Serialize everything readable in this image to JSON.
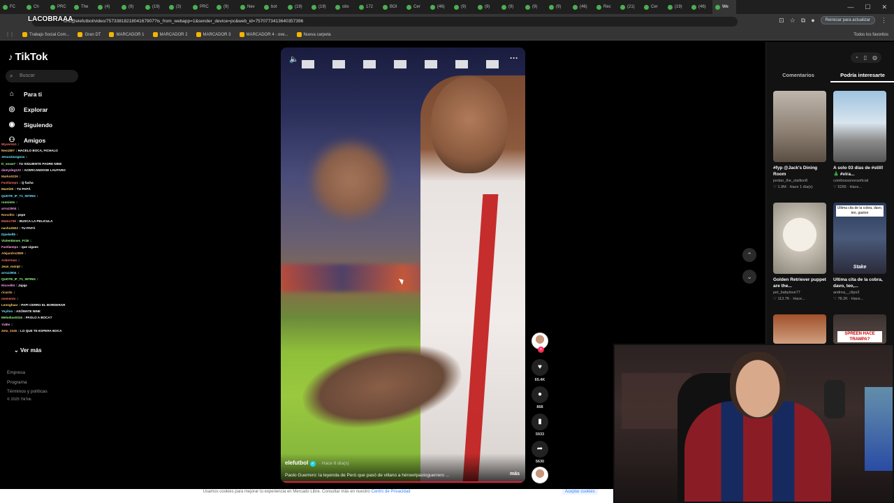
{
  "browser": {
    "tabs": [
      "FC",
      "Ch",
      "PRC",
      "The",
      "(4)",
      "(9)",
      "(19)",
      "(3)",
      "PRC",
      "(9)",
      "Nev",
      "bot",
      "(19)",
      "(19)",
      "obs",
      "172",
      "BOI",
      "Cer",
      "(46)",
      "(9)",
      "(9)",
      "(9)",
      "(9)",
      "(9)",
      "(46)",
      "Rec",
      "(21)",
      "Cer",
      "(19)",
      "(46)",
      "We"
    ],
    "url": "om/@elefutbol/video/7573381821804167907?is_from_webapp=1&sender_device=pc&web_id=7570773413640357396",
    "update_button": "Reiniciar para actualizar",
    "bookmarks": [
      "Trabajo Social Com...",
      "Gran DT",
      "MARCADOR 1",
      "MARCADOR 2",
      "MARCADOR 3",
      "MARCADOR 4 - ove...",
      "Nueva carpeta"
    ],
    "all_favorites": "Todos los favoritos"
  },
  "overlay_title": "LACOBRAAA",
  "sidebar": {
    "logo": "TikTok",
    "search_placeholder": "Buscar",
    "nav": [
      {
        "label": "Para ti",
        "icon": "home-icon"
      },
      {
        "label": "Explorar",
        "icon": "compass-icon"
      },
      {
        "label": "Siguiendo",
        "icon": "following-icon"
      },
      {
        "label": "Amigos",
        "icon": "friends-icon"
      }
    ],
    "ver_mas": "Ver más",
    "footer": [
      "Empresa",
      "Programa",
      "Términos y políticas",
      "© 2025 TikTok"
    ]
  },
  "chat": [
    {
      "user": "Wyvernn1",
      "msg": ""
    },
    {
      "user": "Neo1807",
      "msg": "HACELO BOCA, FICHALO"
    },
    {
      "user": "JesusZaragoza",
      "msg": ""
    },
    {
      "user": "D_snow7",
      "msg": "TU SIGUIENTE PADRE NINE"
    },
    {
      "user": "damydeg123",
      "msg": "ACERCANDOSE LAUTARO"
    },
    {
      "user": "Marko0226",
      "msg": ""
    },
    {
      "user": "Fastlaneps",
      "msg": "Q facha"
    },
    {
      "user": "Manti29",
      "msg": "TU PAPÁ"
    },
    {
      "user": "QUOTE_IF_T1_INTING",
      "msg": ""
    },
    {
      "user": "ronnin0s",
      "msg": ""
    },
    {
      "user": "arroz2904",
      "msg": ""
    },
    {
      "user": "Nonolito",
      "msg": "pepe"
    },
    {
      "user": "Mateo799",
      "msg": "BUSCA LA PELICULA"
    },
    {
      "user": "nacho2503",
      "msg": "TU PAPÁ"
    },
    {
      "user": "Djaskell8",
      "msg": ""
    },
    {
      "user": "ViolentInnes_FCB",
      "msg": ""
    },
    {
      "user": "Fastlaneps",
      "msg": "que sigues"
    },
    {
      "user": "Alejandro2899",
      "msg": ""
    },
    {
      "user": "Ackerman",
      "msg": ""
    },
    {
      "user": "Jean_m4rq0",
      "msg": ""
    },
    {
      "user": "arroz2904",
      "msg": ""
    },
    {
      "user": "QUOTE_IF_T1_INTING",
      "msg": ""
    },
    {
      "user": "Nicool94",
      "msg": "Jajaja"
    },
    {
      "user": "ricardo",
      "msg": ""
    },
    {
      "user": "memento",
      "msg": ""
    },
    {
      "user": "Leonghaar",
      "msg": "PAPI CERRO EL BORDERAR"
    },
    {
      "user": "Yeyitoo",
      "msg": "ASÓMATE NINE"
    },
    {
      "user": "Melodias0316",
      "msg": "PAOLO A BOCA?"
    },
    {
      "user": "Yu8te",
      "msg": ""
    },
    {
      "user": "Zeta_2345",
      "msg": "LO QUE TE ESPERA BOCA"
    }
  ],
  "video": {
    "author": "elefutbol",
    "time_ago": "· Hace 6 día(s)",
    "description": "Paolo Guerrero: la leyenda de Perú que pasó de villano a héroe#paologuerrero ...",
    "more": "más"
  },
  "actions": {
    "likes": "65.4K",
    "comments": "868",
    "saves": "5933",
    "shares": "5630"
  },
  "right_panel": {
    "tabs": [
      "Comentarios",
      "Podría interesarte"
    ],
    "cards": [
      {
        "title": "#fyp @Jack's Dining Room",
        "author": "jordan_the_stallion8",
        "likes": "1.9M",
        "time": "Hace 1 día(s)"
      },
      {
        "title": "A solo 03 días de #still! 🎄 #vira...",
        "author": "combossonoraoficial",
        "likes": "5265",
        "time": "Hace..."
      },
      {
        "title": "Golden Retriever puppet are the...",
        "author": "pet_babylove77",
        "likes": "113.7K",
        "time": "Hace..."
      },
      {
        "title": "Ultima cita de la cobra, davo, teo,...",
        "author": "andrea__clips3",
        "likes": "78.2K",
        "time": "Hace..."
      },
      {
        "title": "",
        "author": "",
        "likes": "",
        "time": ""
      },
      {
        "title": "",
        "author": "",
        "likes": "",
        "time": ""
      }
    ],
    "card_overlay_1": "Ultima cita de la cobra, davo, teo, gaston",
    "card_overlay_stake": "Stake",
    "card_overlay_2": "SPREEN HACE TRAMPA?"
  },
  "cookie": {
    "text": "Usamos cookies para mejorar tu experiencia en Mercado Libre. Consultar más en nuestro ",
    "link": "Centro de Privacidad",
    "accept": "Aceptar cookies"
  }
}
